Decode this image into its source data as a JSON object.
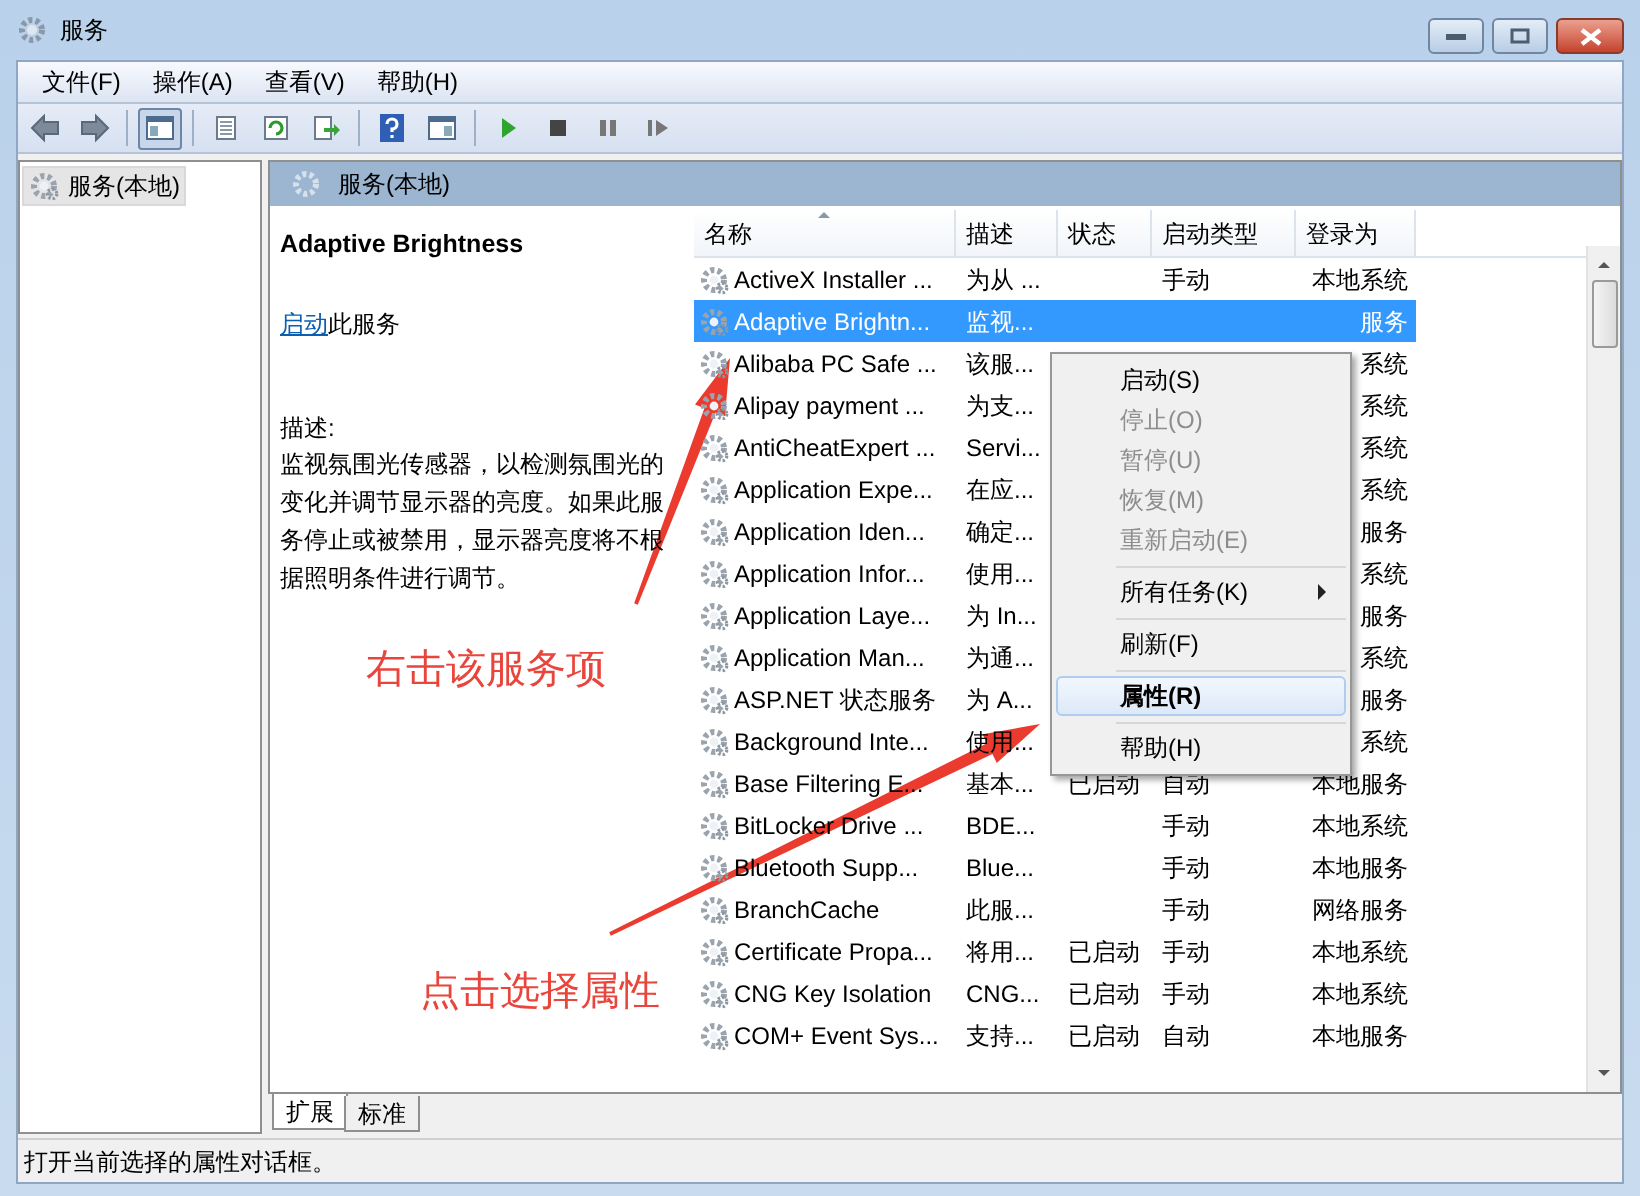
{
  "window": {
    "title": "服务"
  },
  "menu_bar": [
    "文件(F)",
    "操作(A)",
    "查看(V)",
    "帮助(H)"
  ],
  "toolbar": {
    "console_tree_pressed": true
  },
  "tree": [
    {
      "label": "服务(本地)",
      "selected": true
    }
  ],
  "panel": {
    "title": "服务(本地)"
  },
  "details": {
    "service_name": "Adaptive Brightness",
    "action_link": "启动",
    "action_text": "此服务",
    "description_label": "描述:",
    "description": "监视氛围光传感器，以检测氛围光的变化并调节显示器的亮度。如果此服务停止或被禁用，显示器亮度将不根据照明条件进行调节。"
  },
  "table": {
    "columns": [
      {
        "label": "名称",
        "sorted": true
      },
      {
        "label": "描述",
        "sorted": false
      },
      {
        "label": "状态",
        "sorted": false
      },
      {
        "label": "启动类型",
        "sorted": false
      },
      {
        "label": "登录为",
        "sorted": false
      }
    ],
    "rows": [
      {
        "name": "ActiveX Installer ...",
        "description": "为从 ...",
        "status": "",
        "startup_type": "手动",
        "log_on_as": "本地系统",
        "selected": false
      },
      {
        "name": "Adaptive Brightn...",
        "description": "监视...",
        "status": "",
        "startup_type": "",
        "log_on_as": "服务",
        "selected": true
      },
      {
        "name": "Alibaba PC Safe ...",
        "description": "该服...",
        "status": "",
        "startup_type": "",
        "log_on_as": "系统",
        "selected": false
      },
      {
        "name": "Alipay payment ...",
        "description": "为支...",
        "status": "",
        "startup_type": "",
        "log_on_as": "系统",
        "selected": false
      },
      {
        "name": "AntiCheatExpert ...",
        "description": "Servi...",
        "status": "",
        "startup_type": "",
        "log_on_as": "系统",
        "selected": false
      },
      {
        "name": "Application Expe...",
        "description": "在应...",
        "status": "",
        "startup_type": "",
        "log_on_as": "系统",
        "selected": false
      },
      {
        "name": "Application Iden...",
        "description": "确定...",
        "status": "",
        "startup_type": "",
        "log_on_as": "服务",
        "selected": false
      },
      {
        "name": "Application Infor...",
        "description": "使用...",
        "status": "",
        "startup_type": "",
        "log_on_as": "系统",
        "selected": false
      },
      {
        "name": "Application Laye...",
        "description": "为 In...",
        "status": "",
        "startup_type": "",
        "log_on_as": "服务",
        "selected": false
      },
      {
        "name": "Application Man...",
        "description": "为通...",
        "status": "",
        "startup_type": "",
        "log_on_as": "系统",
        "selected": false
      },
      {
        "name": "ASP.NET 状态服务",
        "description": "为 A...",
        "status": "",
        "startup_type": "",
        "log_on_as": "服务",
        "selected": false
      },
      {
        "name": "Background Inte...",
        "description": "使用...",
        "status": "",
        "startup_type": "",
        "log_on_as": "系统",
        "selected": false
      },
      {
        "name": "Base Filtering E...",
        "description": "基本...",
        "status": "已启动",
        "startup_type": "自动",
        "log_on_as": "本地服务",
        "selected": false
      },
      {
        "name": "BitLocker Drive ...",
        "description": "BDE...",
        "status": "",
        "startup_type": "手动",
        "log_on_as": "本地系统",
        "selected": false
      },
      {
        "name": "Bluetooth Supp...",
        "description": "Blue...",
        "status": "",
        "startup_type": "手动",
        "log_on_as": "本地服务",
        "selected": false
      },
      {
        "name": "BranchCache",
        "description": "此服...",
        "status": "",
        "startup_type": "手动",
        "log_on_as": "网络服务",
        "selected": false
      },
      {
        "name": "Certificate Propa...",
        "description": "将用...",
        "status": "已启动",
        "startup_type": "手动",
        "log_on_as": "本地系统",
        "selected": false
      },
      {
        "name": "CNG Key Isolation",
        "description": "CNG...",
        "status": "已启动",
        "startup_type": "手动",
        "log_on_as": "本地系统",
        "selected": false
      },
      {
        "name": "COM+ Event Sys...",
        "description": "支持...",
        "status": "已启动",
        "startup_type": "自动",
        "log_on_as": "本地服务",
        "selected": false
      }
    ]
  },
  "context_menu": {
    "items": [
      {
        "kind": "item",
        "label": "启动(S)",
        "disabled": false,
        "selected": false,
        "default": false
      },
      {
        "kind": "item",
        "label": "停止(O)",
        "disabled": true,
        "selected": false,
        "default": false
      },
      {
        "kind": "item",
        "label": "暂停(U)",
        "disabled": true,
        "selected": false,
        "default": false
      },
      {
        "kind": "item",
        "label": "恢复(M)",
        "disabled": true,
        "selected": false,
        "default": false
      },
      {
        "kind": "item",
        "label": "重新启动(E)",
        "disabled": true,
        "selected": false,
        "default": false
      },
      {
        "kind": "separator"
      },
      {
        "kind": "submenu",
        "label": "所有任务(K)",
        "disabled": false,
        "selected": false,
        "default": false
      },
      {
        "kind": "separator"
      },
      {
        "kind": "item",
        "label": "刷新(F)",
        "disabled": false,
        "selected": false,
        "default": false
      },
      {
        "kind": "separator"
      },
      {
        "kind": "item",
        "label": "属性(R)",
        "disabled": false,
        "selected": true,
        "default": true
      },
      {
        "kind": "separator"
      },
      {
        "kind": "item",
        "label": "帮助(H)",
        "disabled": false,
        "selected": false,
        "default": false
      }
    ]
  },
  "view_tabs": [
    {
      "label": "扩展",
      "selected": true
    },
    {
      "label": "标准",
      "selected": false
    }
  ],
  "annotations": [
    {
      "text": "右击该服务项"
    },
    {
      "text": "点击选择属性"
    }
  ],
  "status_bar": "打开当前选择的属性对话框。"
}
